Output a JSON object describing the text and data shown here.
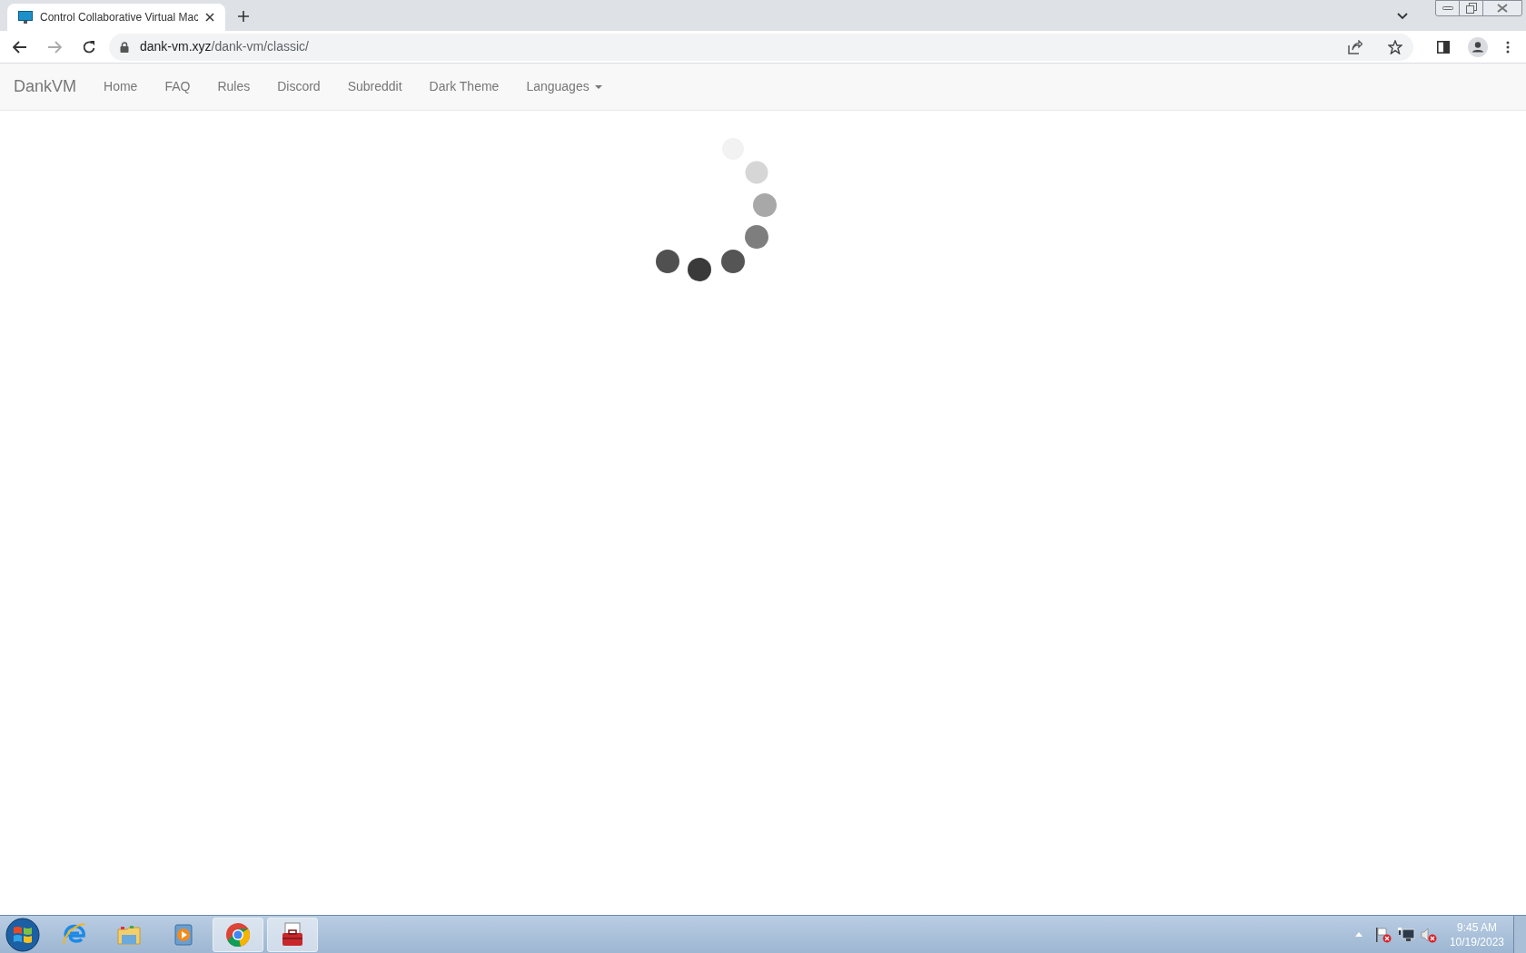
{
  "browser": {
    "tab_title": "Control Collaborative Virtual Mac",
    "url_host": "dank-vm.xyz",
    "url_path": "/dank-vm/classic/"
  },
  "navbar": {
    "brand": "DankVM",
    "items": [
      {
        "label": "Home",
        "kind": "link"
      },
      {
        "label": "FAQ",
        "kind": "link"
      },
      {
        "label": "Rules",
        "kind": "link"
      },
      {
        "label": "Discord",
        "kind": "link"
      },
      {
        "label": "Subreddit",
        "kind": "link"
      },
      {
        "label": "Dark Theme",
        "kind": "link"
      },
      {
        "label": "Languages",
        "kind": "dropdown"
      }
    ]
  },
  "taskbar": {
    "apps": [
      {
        "kind": "ie",
        "selected": false
      },
      {
        "kind": "explorer",
        "selected": false
      },
      {
        "kind": "media",
        "selected": false
      },
      {
        "kind": "chrome",
        "selected": true
      },
      {
        "kind": "toolbox",
        "selected": true
      }
    ],
    "time": "9:45 AM",
    "date": "10/19/2023"
  }
}
